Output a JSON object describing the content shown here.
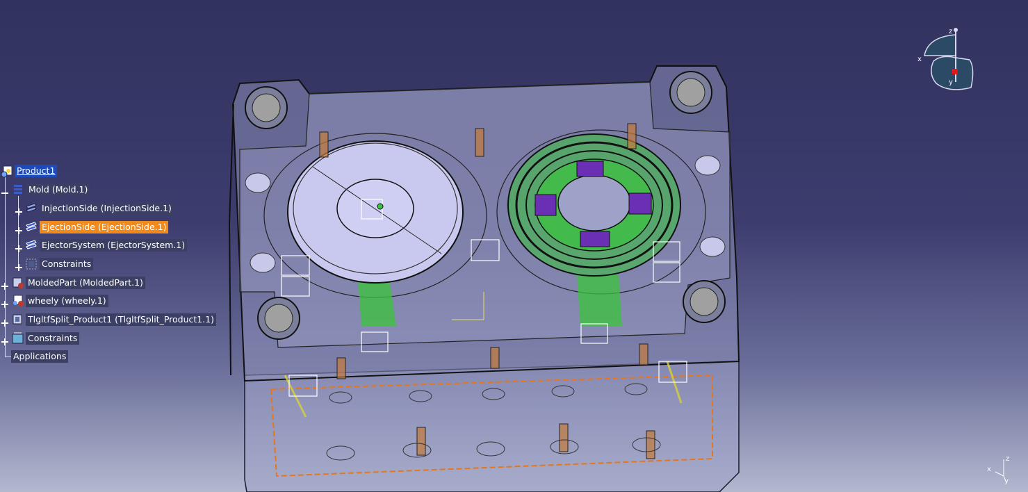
{
  "specification_tree": {
    "root": "Product1",
    "items": [
      {
        "label": "Mold (Mold.1)",
        "icon": "assembly-icon",
        "expander": "minus"
      },
      {
        "label": "InjectionSide (InjectionSide.1)",
        "icon": "plate-stack-icon",
        "expander": "plus"
      },
      {
        "label": "EjectionSide (EjectionSide.1)",
        "icon": "plate-stack-icon",
        "expander": "plus",
        "selected": true
      },
      {
        "label": "EjectorSystem (EjectorSystem.1)",
        "icon": "plate-stack-icon",
        "expander": "plus"
      },
      {
        "label": "Constraints",
        "icon": "constraints-icon",
        "expander": "plus"
      },
      {
        "label": "MoldedPart (MoldedPart.1)",
        "icon": "part-icon",
        "expander": "plus"
      },
      {
        "label": "wheely (wheely.1)",
        "icon": "product-icon",
        "expander": "plus"
      },
      {
        "label": "TlgltfSplit_Product1 (TlgltfSplit_Product1.1)",
        "icon": "part-icon",
        "expander": "plus"
      },
      {
        "label": "Constraints",
        "icon": "constraints-icon",
        "expander": "plus"
      },
      {
        "label": "Applications",
        "icon": "",
        "expander": "none"
      }
    ]
  },
  "compass": {
    "x_label": "x",
    "y_label": "y",
    "z_label": "z"
  },
  "axis_triad": {
    "x_label": "x",
    "y_label": "y",
    "z_label": "z"
  },
  "colors": {
    "background_top": "#32325f",
    "background_bottom": "#b3b8cf",
    "selection": "#f08a1d",
    "root_highlight": "#1f4bb8",
    "mold_translucent": "#8c8fb8",
    "insert_cavity": "#c9c8ee",
    "purple_part": "#6a2fb5",
    "green_part": "#39c43a"
  }
}
